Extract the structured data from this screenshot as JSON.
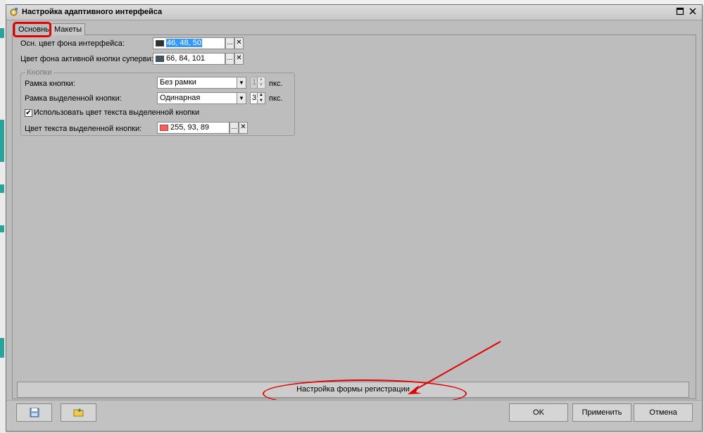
{
  "window": {
    "title": "Настройка адаптивного интерфейса"
  },
  "tabs": [
    {
      "label": "Основные",
      "active": true
    },
    {
      "label": "Макеты",
      "active": false
    }
  ],
  "main": {
    "bg_color_label": "Осн. цвет фона интерфейса:",
    "bg_color_value": "46, 48, 50",
    "bg_color_swatch": "#2e3032",
    "supervisor_color_label": "Цвет фона активной кнопки супервизора:",
    "supervisor_color_value": "66, 84, 101",
    "supervisor_color_swatch": "#425465",
    "browse_label": "...",
    "clear_label": "✕"
  },
  "buttons_group": {
    "legend": "Кнопки",
    "frame_label": "Рамка кнопки:",
    "frame_value": "Без рамки",
    "frame_spin_value": "1",
    "selected_frame_label": "Рамка выделенной кнопки:",
    "selected_frame_value": "Одинарная",
    "selected_frame_spin_value": "3",
    "px_label": "пкс.",
    "use_text_color_label": "Использовать цвет текста выделенной кнопки",
    "use_text_color_checked": true,
    "text_color_label": "Цвет текста выделенной кнопки:",
    "text_color_value": "255, 93, 89",
    "text_color_swatch": "#ff5d59"
  },
  "registration_button": "Настройка формы регистрации",
  "footer": {
    "ok": "OK",
    "apply": "Применить",
    "cancel": "Отмена"
  }
}
